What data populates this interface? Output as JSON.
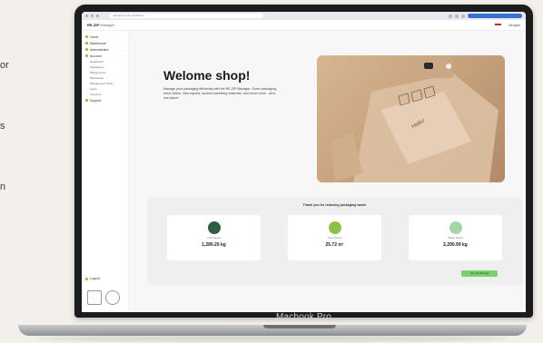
{
  "left_edge_text": [
    "or",
    "s",
    "n"
  ],
  "browser": {
    "url": "manager.re-zip.com/home"
  },
  "app": {
    "brand": "RE-ZIP",
    "brand_suffix": "Manager",
    "user": "Bengtsk"
  },
  "sidebar": {
    "items": [
      {
        "label": "Home",
        "chevron": ""
      },
      {
        "label": "Warehouse",
        "chevron": "⌄"
      },
      {
        "label": "Administrator",
        "chevron": "⌄"
      },
      {
        "label": "Account",
        "chevron": "⌃"
      }
    ],
    "subitems": [
      "Dashboard",
      "Packagings",
      "Shipping Info",
      "Warehouse",
      "Management Tools",
      "Users",
      "Inventory"
    ],
    "support": "Support",
    "logout": "Logout"
  },
  "main": {
    "welcome": "Welome shop!",
    "description": "Manage your packaging efficiently with the RE-ZIP Manager. Order packaging, track orders, view reports, access marketing materials, and much more - all in one place!",
    "hero_text": "Hello!"
  },
  "stats": {
    "title": "Thank you for reducing packaging waste",
    "cards": [
      {
        "label": "CO2 Saved",
        "value": "1,289.26 kg",
        "color": "#2f5f45"
      },
      {
        "label": "Trees Saved",
        "value": "25.72 m²",
        "color": "#8bc34a"
      },
      {
        "label": "Waste Saved",
        "value": "2,290.99 kg",
        "color": "#a5d6a7"
      }
    ],
    "button": "See All Savings"
  },
  "device_label": "Macbook Pro"
}
